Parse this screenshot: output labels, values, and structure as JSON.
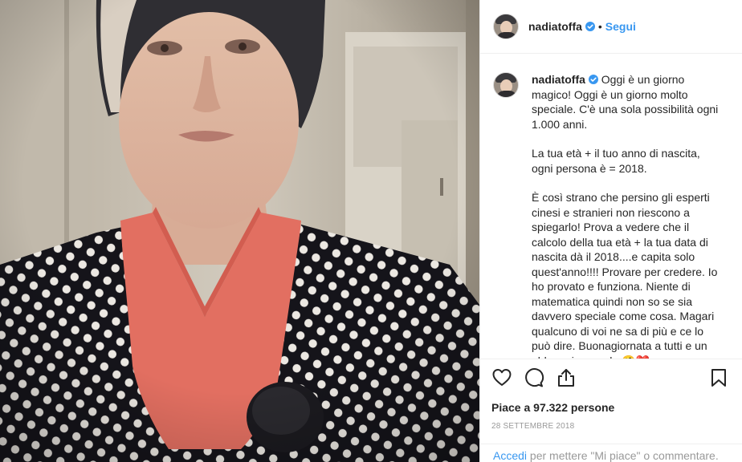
{
  "post": {
    "username": "nadiatoffa",
    "follow_label": "Segui",
    "separator": "•",
    "verified_icon": "verified-badge-icon"
  },
  "caption": {
    "username": "nadiatoffa",
    "p1": "Oggi è un giorno\nmagico! Oggi è un giorno molto\nspeciale. C'è una sola possibilità ogni\n1.000 anni.",
    "p2": "La tua età + il tuo anno di nascita,\nogni persona è = 2018.",
    "p3": "È così strano che persino gli esperti\ncinesi e stranieri non riescono a\nspiegarlo! Prova a vedere che il\ncalcolo della tua età + la tua data di\nnascita dà il 2018....e capita solo\nquest'anno!!!! Provare per credere. Io\nho provato e funziona. Niente di\nmatematica quindi non so se sia\ndavvero speciale come cosa. Magari\nqualcuno di voi ne sa di più e ce lo\npuò dire. Buonagiornata a tutti e un\nabbraccio grande 🤗❤️"
  },
  "actions": {
    "icons": [
      "heart-icon",
      "comment-icon",
      "share-icon",
      "bookmark-icon"
    ],
    "likes_prefix": "Piace a ",
    "likes_count": "97.322",
    "likes_suffix": " persone",
    "date": "28 settembre 2018"
  },
  "footer": {
    "login_label": "Accedi",
    "rest": " per mettere \"Mi piace\" o commentare."
  },
  "colors": {
    "link": "#3897f0",
    "text": "#262626",
    "muted": "#999999",
    "border": "#efefef"
  }
}
